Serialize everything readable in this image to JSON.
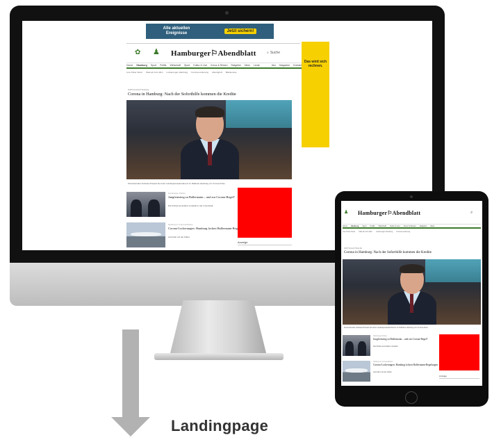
{
  "desktop": {
    "ad_banner": {
      "line1": "Alle aktuellen",
      "line2": "Ereignisse",
      "button": "Jetzt sichern!"
    },
    "logo": "Hamburger⚐Abendblatt",
    "search": "Suche",
    "nav": [
      "Home",
      "Hamburg",
      "Sport",
      "Politik",
      "Wirtschaft",
      "Sport",
      "Kultur & Live",
      "Kreuz & Reisen",
      "Ratgeber",
      "Meer",
      "Leute"
    ],
    "nav_right": [
      "Abo",
      "Magazine",
      "Kontakt"
    ],
    "subnav": [
      "Live-Ticker News",
      "Kitas ab Juni offen",
      "Lockerungen Hamburg",
      "Corona-Lockerung",
      "Abendgruß",
      "Blankenese"
    ],
    "side_ad": "Das wird sich rechnen.",
    "kicker": "Wirtschaftshilfe",
    "headline": "Corona in Hamburg: Nach der Soforthilfe kommen die Kredite",
    "caption": "Finanzsenator Andreas Dressel bei einer Landespressekonferenz im Rathaus Hamburg zur Corona-Krise",
    "teasers": [
      {
        "kicker": "Hamburger Polizei",
        "title": "Jungfernstieg zu Ballermann – und zur Corona-Regel?",
        "text": "Die Polizei kontrolliert verstärkt in der Innenstadt"
      },
      {
        "kicker": "Harburg im Corona-Modus",
        "title": "Corona-Lockerungen: Hamburg lockert Ballermann-Regelungen",
        "text": "Auf Fahrt mit der Fähre"
      }
    ],
    "side_label": "Anzeige"
  },
  "tablet": {
    "logo": "Hamburger⚐Abendblatt",
    "kicker": "Wirtschaftshilfe",
    "headline": "Corona in Hamburg: Nach der Soforthilfe kommen die Kredite",
    "caption": "Finanzsenator Andreas Dressel bei einer Landespressekonferenz im Rathaus Hamburg zur Corona-Krise",
    "teasers": [
      {
        "kicker": "Hamburger Polizei",
        "title": "Jungfernstieg zu Ballermann – und zur Corona-Regel?",
        "text": "Die Polizei kontrolliert verstärkt"
      },
      {
        "kicker": "Harburg im Corona-Modus",
        "title": "Corona-Lockerungen: Hamburg lockert Ballermann-Regelungen",
        "text": "Auf Fahrt mit der Fähre"
      }
    ],
    "side_label": "Anzeige"
  },
  "label": "Landingpage",
  "colors": {
    "ad_red": "#ff0000",
    "ad_yellow": "#f6d000",
    "nav_green": "#3d7a2a",
    "arrow": "#b2b2b2"
  }
}
